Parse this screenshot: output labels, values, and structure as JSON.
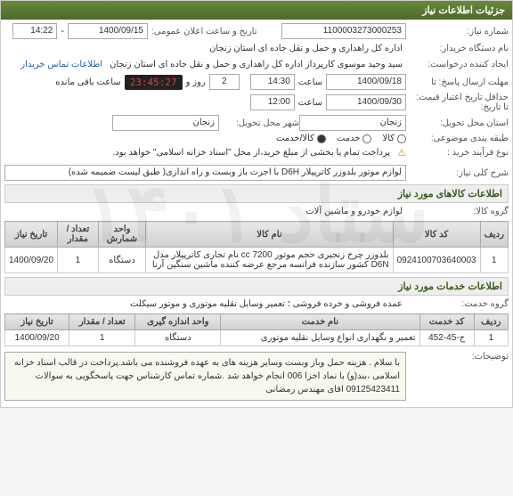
{
  "header": {
    "title": "جزئیات اطلاعات نیاز"
  },
  "fields": {
    "need_no_lbl": "شماره نیاز:",
    "need_no": "1100003273000253",
    "announce_lbl": "تاریخ و ساعت اعلان عمومی:",
    "announce_date": "1400/09/15",
    "announce_time": "14:22",
    "buyer_org_lbl": "نام دستگاه خریدار:",
    "buyer_org": "اداره کل راهداری و حمل و نقل جاده ای استان زنجان",
    "creator_lbl": "ایجاد کننده درخواست:",
    "creator": "سید وحید موسوی کارپرداز اداره کل راهداری و حمل و نقل جاده ای استان زنجان",
    "contact_link": "اطلاعات تماس خریدار",
    "reply_deadline_lbl": "مهلت ارسال پاسخ: تا",
    "reply_date": "1400/09/18",
    "reply_hour_lbl": "ساعت",
    "reply_hour": "14:30",
    "countdown_pre": "2",
    "countdown_day_lbl": "روز و",
    "countdown": "23:45:27",
    "countdown_suffix": "ساعت باقی مانده",
    "min_valid_lbl": "حداقل تاریخ اعتبار قیمت: تا تاریخ:",
    "min_valid_date": "1400/09/30",
    "min_valid_hour_lbl": "ساعت",
    "min_valid_hour": "12:00",
    "province_lbl": "استان محل تحویل:",
    "province": "زنجان",
    "city_lbl": "شهر محل تحویل:",
    "city": "زنجان",
    "category_lbl": "طبقه بندی موضوعی:",
    "cat_goods": "کالا",
    "cat_service": "خدمت",
    "cat_both": "کالا/خدمت",
    "purchase_type_lbl": "نوع فرآیند خرید :",
    "purchase_note": "پرداخت تمام یا بخشی از مبلغ خرید،از محل \"اسناد خزانه اسلامی\" خواهد بود.",
    "need_desc_lbl": "شرح کلی نیاز:",
    "need_desc": "لوازم موتور بلدوزر کاترپیلار D6H با اجرت باز وبست و راه اندازی( طبق لیست ضمیمه شده)"
  },
  "goods_section": {
    "title": "اطلاعات کالاهای مورد نیاز",
    "group_lbl": "گروه کالا:",
    "group": "لوازم خودرو و ماشین آلات"
  },
  "goods_table": {
    "headers": {
      "row": "ردیف",
      "code": "کد کالا",
      "name": "نام کالا",
      "unit": "واحد شمارش",
      "qty": "تعداد / مقدار",
      "date": "تاریخ نیاز"
    },
    "rows": [
      {
        "row": "1",
        "code": "0924100703640003",
        "name": "بلدوزر چرخ زنجیری حجم موتور 7200 cc نام تجاری کاترپیلار مدل D6N کشور سازنده فرانسه مرجع عرضه کننده ماشین سنگین آرنا",
        "unit": "دستگاه",
        "qty": "1",
        "date": "1400/09/20"
      }
    ]
  },
  "services_section": {
    "title": "اطلاعات خدمات مورد نیاز",
    "group_lbl": "گروه خدمت:",
    "group": "عمده فروشی و خرده فروشی ؛ تعمیر وسایل نقلیه موتوری و موتور سیکلت"
  },
  "services_table": {
    "headers": {
      "row": "ردیف",
      "code": "کد خدمت",
      "name": "نام خدمت",
      "unit": "واحد اندازه گیری",
      "qty": "تعداد / مقدار",
      "date": "تاریخ نیاز"
    },
    "rows": [
      {
        "row": "1",
        "code": "ج-45-452",
        "name": "تعمیر و نگهداری انواع وسایل نقلیه موتوری",
        "unit": "دستگاه",
        "qty": "1",
        "date": "1400/09/20"
      }
    ]
  },
  "notes": {
    "lbl": "توضیحات:",
    "text": "با سلام . هزینه حمل وباز وبست وسایر هزینه های به عهده فروشنده می باشد.پرداخت در قالب اسناد خزانه اسلامی ،بند(و) با نماد اخزا 006 انجام خواهد شد .شماره تماس کارشناس جهت پاسخگویی به سوالات 09125423411 اقای مهندس رمضانی"
  },
  "watermark": "ستاد ۱۴۰۱"
}
